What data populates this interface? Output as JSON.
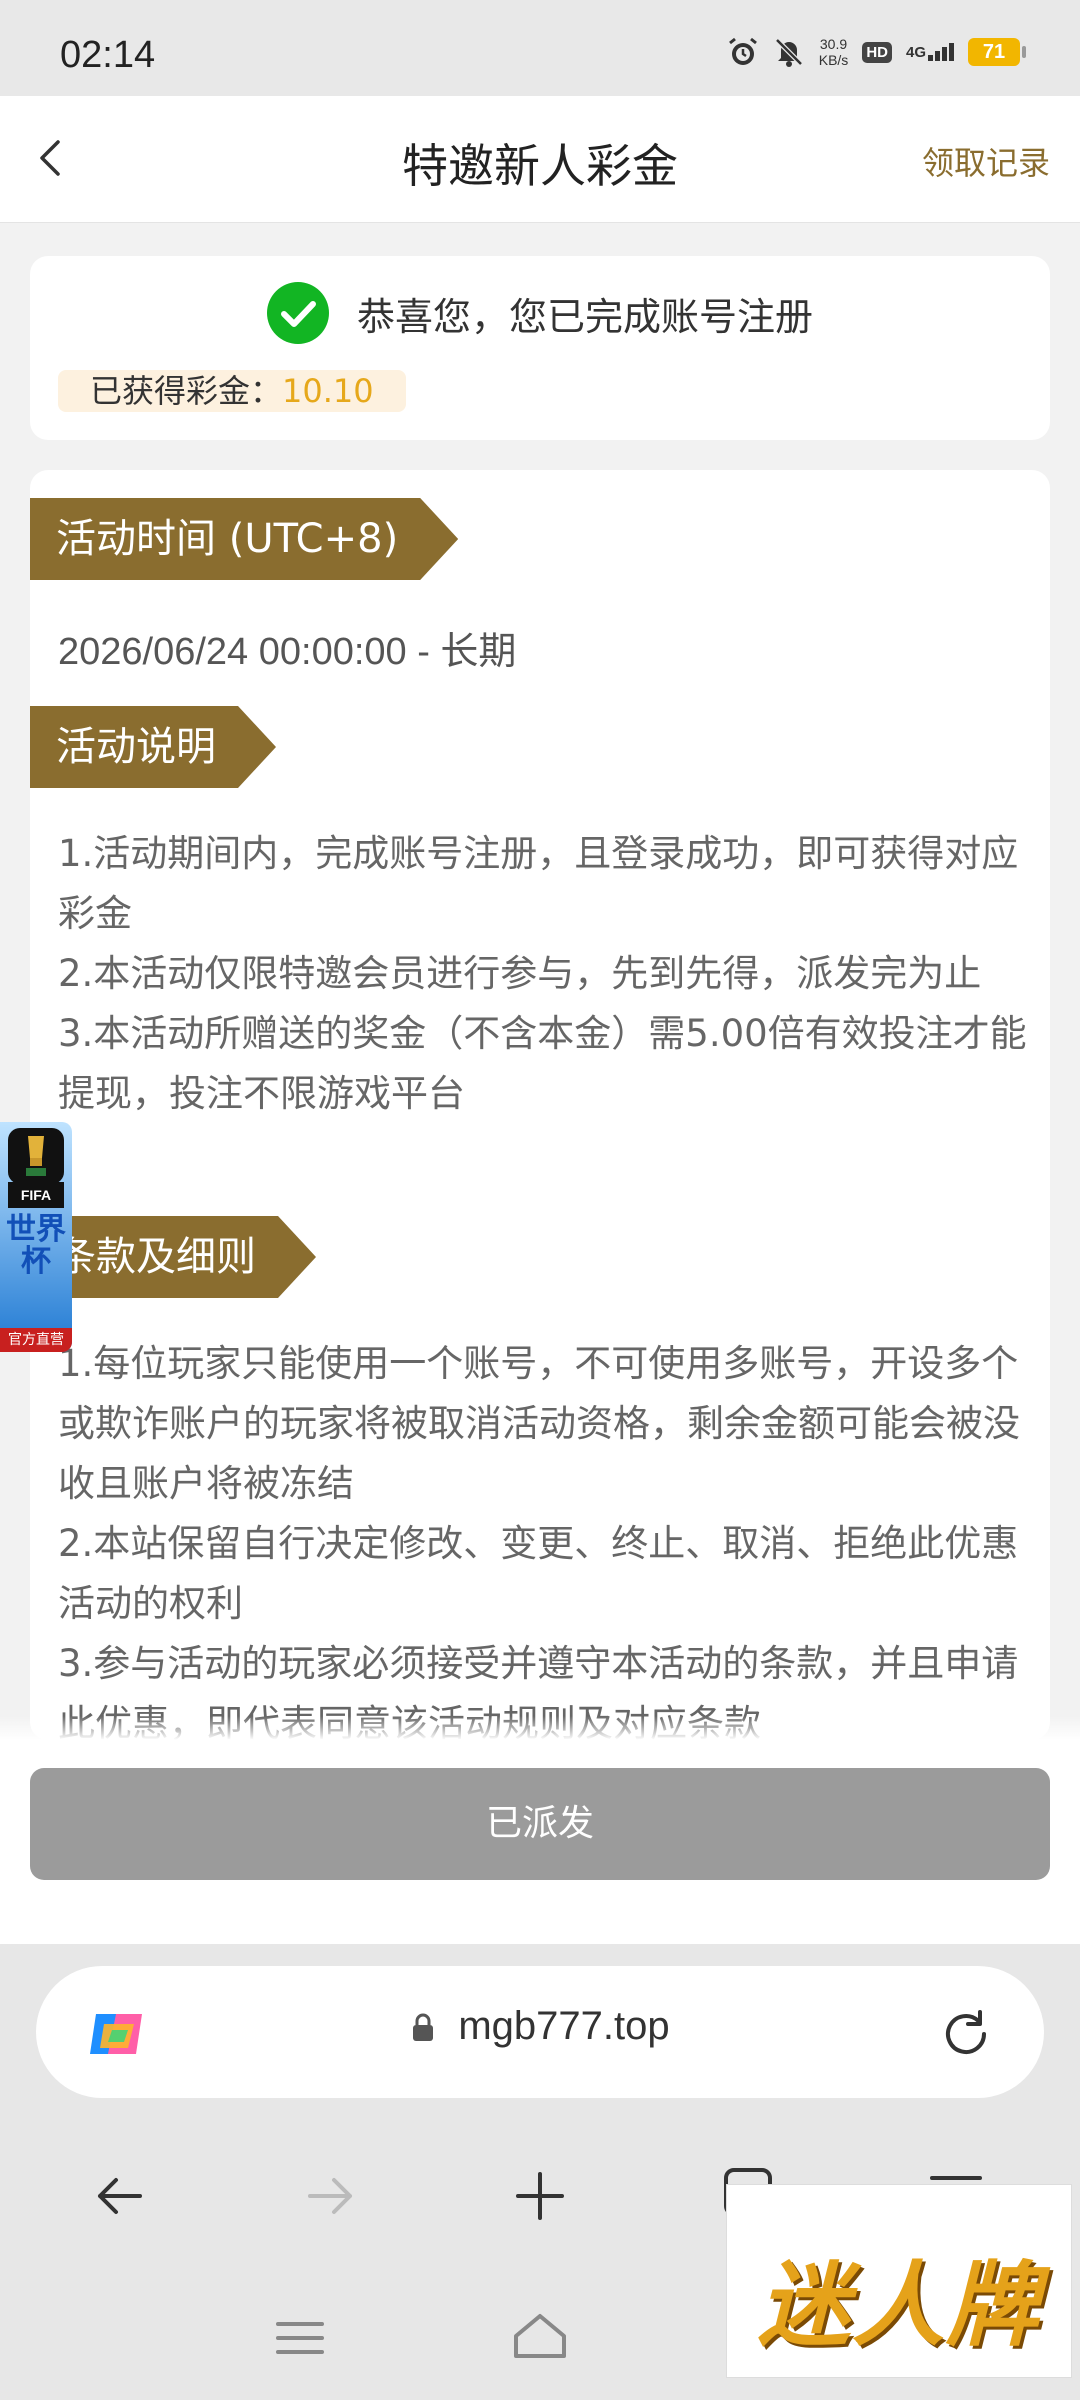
{
  "status_bar": {
    "time": "02:14",
    "net_speed_value": "30.9",
    "net_speed_unit": "KB/s",
    "hd": "HD",
    "signal": "4G",
    "battery": "71"
  },
  "header": {
    "title": "特邀新人彩金",
    "record_link": "领取记录"
  },
  "congrats": {
    "message": "恭喜您，您已完成账号注册",
    "bonus_label": "已获得彩金：",
    "bonus_value": "10.10"
  },
  "sections": {
    "time": {
      "heading": "活动时间 (UTC+8)",
      "value": "2026/06/24 00:00:00 - 长期"
    },
    "description": {
      "heading": "活动说明",
      "items": [
        "1.活动期间内，完成账号注册，且登录成功，即可获得对应彩金",
        "2.本活动仅限特邀会员进行参与，先到先得，派发完为止",
        "3.本活动所赠送的奖金（不含本金）需5.00倍有效投注才能提现，投注不限游戏平台"
      ]
    },
    "terms": {
      "heading": "条款及细则",
      "items": [
        "1.每位玩家只能使用一个账号，不可使用多账号，开设多个或欺诈账户的玩家将被取消活动资格，剩余金额可能会被没收且账户将被冻结",
        "2.本站保留自行决定修改、变更、终止、取消、拒绝此优惠活动的权利",
        "3.参与活动的玩家必须接受并遵守本活动的条款，并且申请此优惠，即代表同意该活动规则及对应条款"
      ]
    }
  },
  "action": {
    "dispatched_label": "已派发"
  },
  "browser": {
    "url": "mgb777.top"
  },
  "floating": {
    "worldcup_fifa": "FIFA",
    "worldcup_name": "世界杯",
    "worldcup_tag": "官方直营",
    "brand_logo_text": "迷人牌"
  },
  "colors": {
    "accent_gold": "#8a6d2f",
    "bonus_value": "#e6a81b",
    "success_green": "#12b523",
    "disabled_button": "#9b9b9b"
  }
}
